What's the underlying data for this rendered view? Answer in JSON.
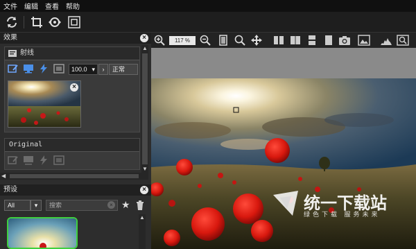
{
  "menu": {
    "items": [
      "文件",
      "编辑",
      "查看",
      "帮助"
    ]
  },
  "toolbar": {
    "icons": [
      "refresh-icon",
      "crop-icon",
      "rotate-icon",
      "fit-icon"
    ]
  },
  "effects_panel": {
    "title": "效果",
    "effect_name": "射线",
    "opacity_value": "100.0",
    "blend_mode": "正常",
    "second_effect_name": "Original"
  },
  "presets_panel": {
    "title": "预设",
    "filter_value": "All",
    "search_placeholder": "搜索"
  },
  "viewer": {
    "zoom": "117 %"
  },
  "watermark": {
    "line1": "统一下载站",
    "line2": "绿色下载 服务未来"
  },
  "colors": {
    "accent_green": "#3fd03f",
    "panel_bg": "#2d2d2d",
    "header_bg": "#202020"
  }
}
